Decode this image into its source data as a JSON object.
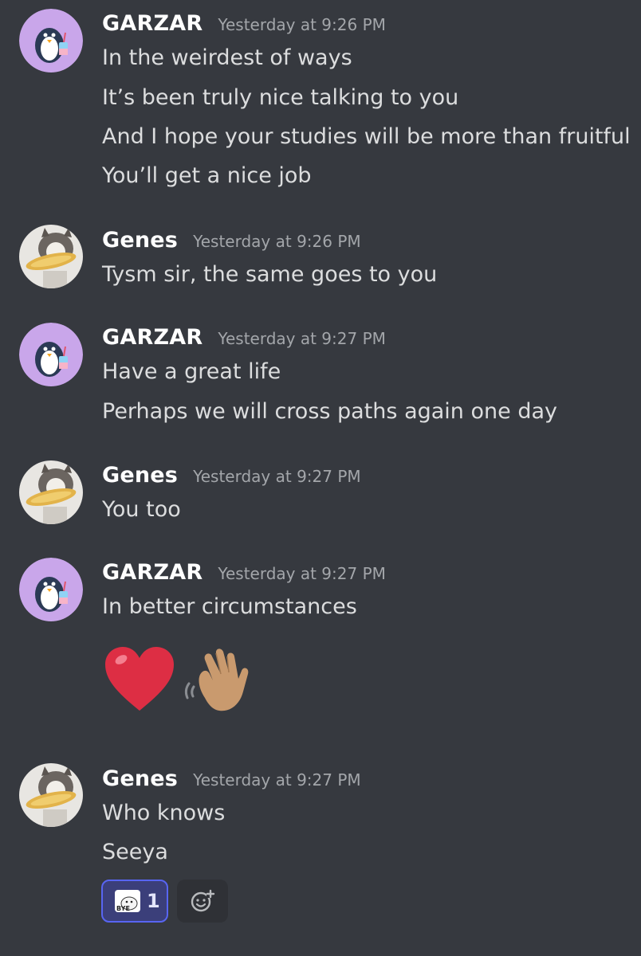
{
  "messages": [
    {
      "author": "GARZAR",
      "timestamp": "Yesterday at 9:26 PM",
      "lines": [
        "In the weirdest of ways",
        "It’s been truly nice talking to you",
        "And I hope your studies will be more than fruitful",
        "You’ll get a nice job"
      ]
    },
    {
      "author": "Genes",
      "timestamp": "Yesterday at 9:26 PM",
      "lines": [
        "Tysm sir, the same goes to you"
      ]
    },
    {
      "author": "GARZAR",
      "timestamp": "Yesterday at 9:27 PM",
      "lines": [
        "Have a great life",
        "Perhaps we will cross paths again one day"
      ]
    },
    {
      "author": "Genes",
      "timestamp": "Yesterday at 9:27 PM",
      "lines": [
        "You too"
      ]
    },
    {
      "author": "GARZAR",
      "timestamp": "Yesterday at 9:27 PM",
      "lines": [
        "In better circumstances"
      ],
      "emojis": [
        "red-heart-emoji",
        "waving-hand-emoji"
      ]
    },
    {
      "author": "Genes",
      "timestamp": "Yesterday at 9:27 PM",
      "lines": [
        "Who knows",
        "Seeya"
      ],
      "reaction": {
        "icon": "bye-sticker-icon",
        "count": "1"
      },
      "add_reaction_icon": "add-reaction-icon"
    }
  ],
  "colors": {
    "background": "#36393f",
    "username": "#ffffff",
    "timestamp": "#a3a6aa",
    "text": "#dcddde",
    "reaction_border": "#5865f2",
    "reaction_bg": "#3b3f7a",
    "garzar_avatar_bg": "#c9a6ea"
  }
}
